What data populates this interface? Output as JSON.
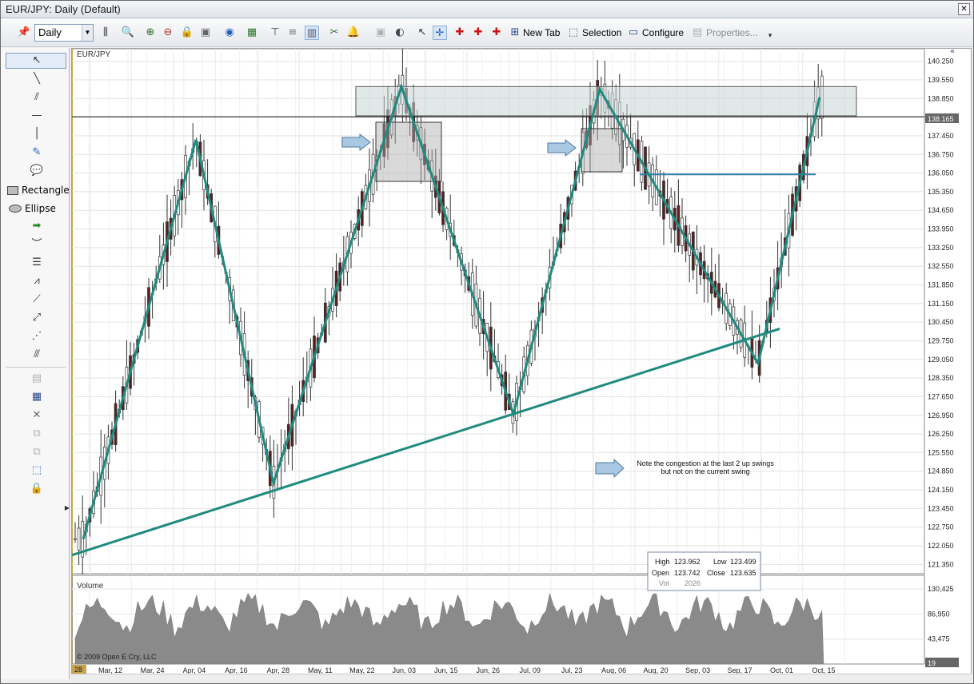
{
  "window": {
    "title": "EUR/JPY: Daily (Default)",
    "close_glyph": "✕"
  },
  "toolbar": {
    "timeframe": "Daily",
    "new_tab": "New Tab",
    "selection": "Selection",
    "configure": "Configure",
    "properties": "Properties..."
  },
  "sidebar": {
    "rectangle": "Rectangle",
    "ellipse": "Ellipse"
  },
  "chart": {
    "symbol": "EUR/JPY",
    "volume_label": "Volume",
    "copyright": "© 2009 Open E Cry, LLC",
    "last_price": "138.165",
    "first_date": "28",
    "note_line1": "Note the congestion at the last 2 up swings",
    "note_line2": "but not on the current swing",
    "volume_last": "19",
    "price_ticks": [
      "140.250",
      "139.550",
      "138.850",
      "138.150",
      "137.450",
      "136.750",
      "136.050",
      "135.350",
      "134.650",
      "133.950",
      "133.250",
      "132.550",
      "131.850",
      "131.150",
      "130.450",
      "129.750",
      "129.050",
      "128.350",
      "127.650",
      "126.950",
      "126.250",
      "125.550",
      "124.850",
      "124.150",
      "123.450",
      "122.750",
      "122.050",
      "121.350"
    ],
    "volume_ticks": [
      "130,425",
      "86,950",
      "43,475"
    ],
    "date_ticks": [
      "Mar, 12",
      "Mar, 24",
      "Apr, 04",
      "Apr, 16",
      "Apr, 28",
      "May, 11",
      "May, 22",
      "Jun, 03",
      "Jun, 15",
      "Jun, 26",
      "Jul, 09",
      "Jul, 23",
      "Aug, 06",
      "Aug, 20",
      "Sep, 03",
      "Sep, 17",
      "Oct, 01",
      "Oct, 15"
    ],
    "infobox": {
      "high_label": "High",
      "high": "123.962",
      "low_label": "Low",
      "low": "123.499",
      "open_label": "Open",
      "open": "123.742",
      "close_label": "Close",
      "close": "123.635",
      "vol_label": "Vol",
      "vol": "2026"
    }
  },
  "chart_data": {
    "type": "candlestick",
    "symbol": "EUR/JPY",
    "ylim": [
      121.0,
      140.6
    ],
    "volume_ylim": [
      0,
      150000
    ],
    "last_price": 138.165,
    "swing_points": [
      {
        "date": "Feb, 28",
        "price": 122.3
      },
      {
        "date": "Apr, 04",
        "price": 137.3
      },
      {
        "date": "Apr, 28",
        "price": 124.4
      },
      {
        "date": "Jun, 08",
        "price": 139.3
      },
      {
        "date": "Jul, 05",
        "price": 127.0
      },
      {
        "date": "Aug, 09",
        "price": 139.2
      },
      {
        "date": "Sep, 20",
        "price": 128.9
      },
      {
        "date": "Oct, 17",
        "price": 138.9
      }
    ],
    "trendline": [
      {
        "date": "Feb, 28",
        "price": 121.7
      },
      {
        "date": "Oct, 03",
        "price": 130.2
      }
    ],
    "resistance_zone": [
      138.2,
      139.0
    ],
    "horizontal_line": 136.0
  }
}
